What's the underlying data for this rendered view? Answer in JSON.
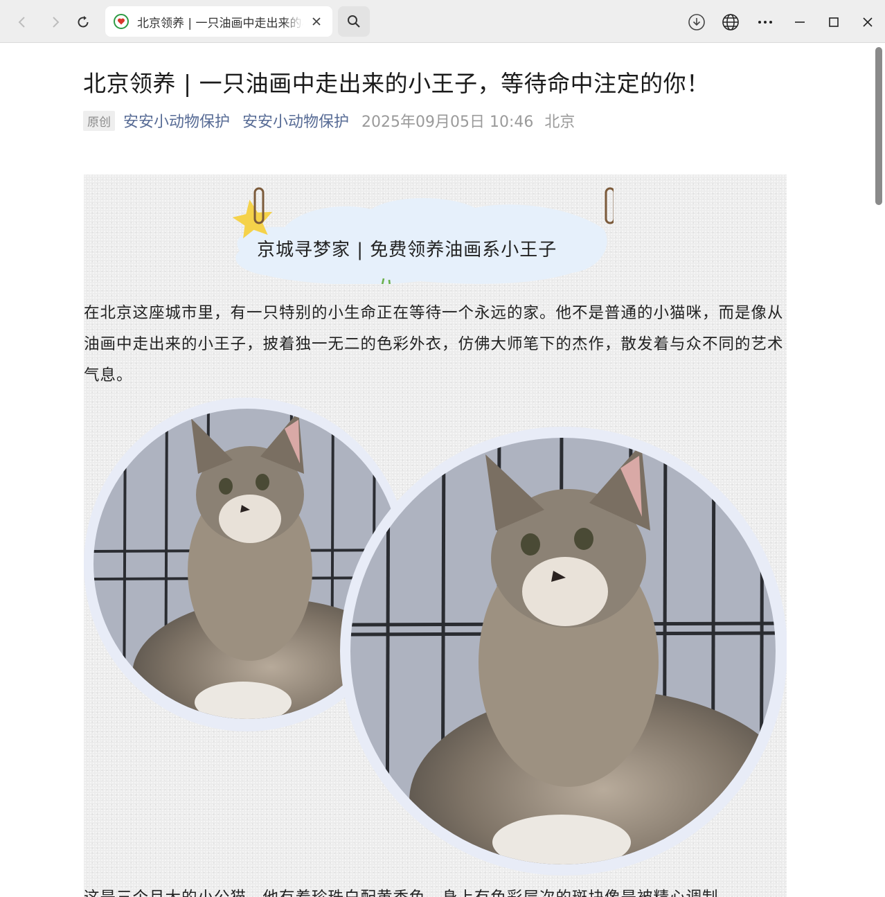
{
  "browser": {
    "tab_title": "北京领养 | 一只油画中走出来的小王子，等待命中注定的你！",
    "icons": [
      "back-icon",
      "forward-icon",
      "reload-icon",
      "close-icon",
      "search-icon",
      "download-icon",
      "globe-icon",
      "more-icon",
      "minimize-icon",
      "maximize-icon",
      "window-close-icon"
    ]
  },
  "article": {
    "title": "北京领养 | 一只油画中走出来的小王子，等待命中注定的你！",
    "badge": "原创",
    "author1": "安安小动物保护",
    "author2": "安安小动物保护",
    "date": "2025年09月05日 10:46",
    "location": "北京",
    "banner": "京城寻梦家 | 免费领养油画系小王子",
    "paragraph1": "在北京这座城市里，有一只特别的小生命正在等待一个永远的家。他不是普通的小猫咪，而是像从油画中走出来的小王子，披着独一无二的色彩外衣，仿佛大师笔下的杰作，散发着与众不同的艺术气息。",
    "paragraph2_partial": "这是三个月大的小公猫，他有着珍珠白配黄香色，身上有色彩层次的斑块像是被精心调制"
  },
  "colors": {
    "link": "#576b95",
    "meta_gray": "#9a9a9a",
    "cloud": "#e6f0fb",
    "ring": "#e8ecf7"
  }
}
